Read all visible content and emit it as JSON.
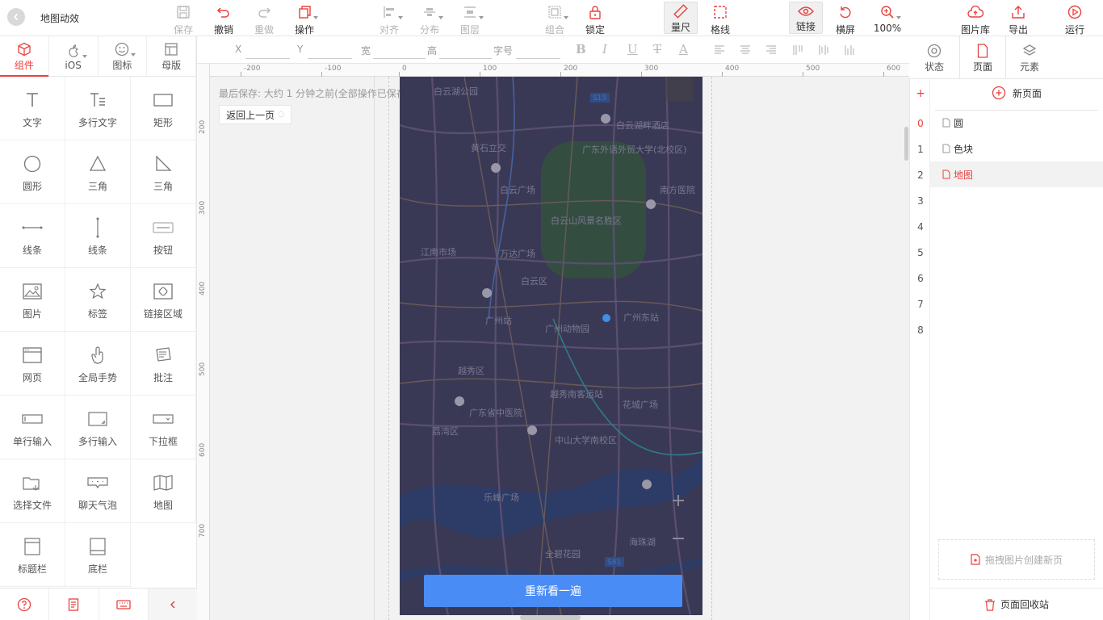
{
  "doc_title": "地图动效",
  "toolbar": [
    {
      "label": "保存",
      "state": "disabled"
    },
    {
      "label": "撤销",
      "state": "normal"
    },
    {
      "label": "重做",
      "state": "disabled"
    },
    {
      "label": "操作",
      "state": "normal"
    },
    {
      "label": "对齐",
      "state": "disabled"
    },
    {
      "label": "分布",
      "state": "disabled"
    },
    {
      "label": "图层",
      "state": "disabled"
    },
    {
      "label": "组合",
      "state": "disabled"
    },
    {
      "label": "锁定",
      "state": "normal"
    },
    {
      "label": "量尺",
      "state": "active"
    },
    {
      "label": "格线",
      "state": "normal"
    },
    {
      "label": "链接",
      "state": "active"
    },
    {
      "label": "横屏",
      "state": "normal"
    },
    {
      "label": "100%",
      "state": "normal"
    },
    {
      "label": "图片库",
      "state": "normal"
    },
    {
      "label": "导出",
      "state": "normal"
    },
    {
      "label": "运行",
      "state": "normal"
    }
  ],
  "left_tabs": [
    "组件",
    "iOS",
    "图标",
    "母版"
  ],
  "components": [
    "文字",
    "多行文字",
    "矩形",
    "圆形",
    "三角",
    "三角",
    "线条",
    "线条",
    "按钮",
    "图片",
    "标签",
    "链接区域",
    "网页",
    "全局手势",
    "批注",
    "单行输入",
    "多行输入",
    "下拉框",
    "选择文件",
    "聊天气泡",
    "地图",
    "标题栏",
    "底栏"
  ],
  "props": {
    "x": "X",
    "y": "Y",
    "w": "宽",
    "h": "高",
    "font": "字号"
  },
  "ruler_h": [
    "-200",
    "-100",
    "0",
    "100",
    "200",
    "300",
    "400",
    "500",
    "600"
  ],
  "ruler_v": [
    "200",
    "300",
    "400",
    "500",
    "600",
    "700"
  ],
  "canvas": {
    "saved_text": "最后保存: 大约 1 分钟之前(全部操作已保存)",
    "back_button": "返回上一页",
    "cta": "重新看一遍"
  },
  "map_labels": [
    "白云湖公园",
    "白云湖畔酒店",
    "黄石立交",
    "广东外语外贸大学(北校区)",
    "白云广场",
    "南方医院",
    "白云山风景名胜区",
    "江南市场",
    "万达广场",
    "白云区",
    "广州站",
    "广州东站",
    "广州动物园",
    "越秀区",
    "广东省中医院",
    "越秀南客运站",
    "花城广场",
    "荔湾区",
    "中山大学南校区",
    "海珠湖",
    "乐峰广场",
    "全碧花园",
    "S15",
    "S81"
  ],
  "right_tabs": [
    "状态",
    "页面",
    "元素"
  ],
  "pages": {
    "new_page": "新页面",
    "list": [
      "圆",
      "色块",
      "地图"
    ],
    "selected": 2,
    "numbers": [
      "0",
      "1",
      "2",
      "3",
      "4",
      "5",
      "6",
      "7",
      "8"
    ],
    "drop_hint": "拖拽图片创建新页",
    "trash": "页面回收站"
  },
  "colors": {
    "accent": "#e8413e",
    "cta": "#4a8cf6",
    "map_overlay": "#33324d"
  }
}
